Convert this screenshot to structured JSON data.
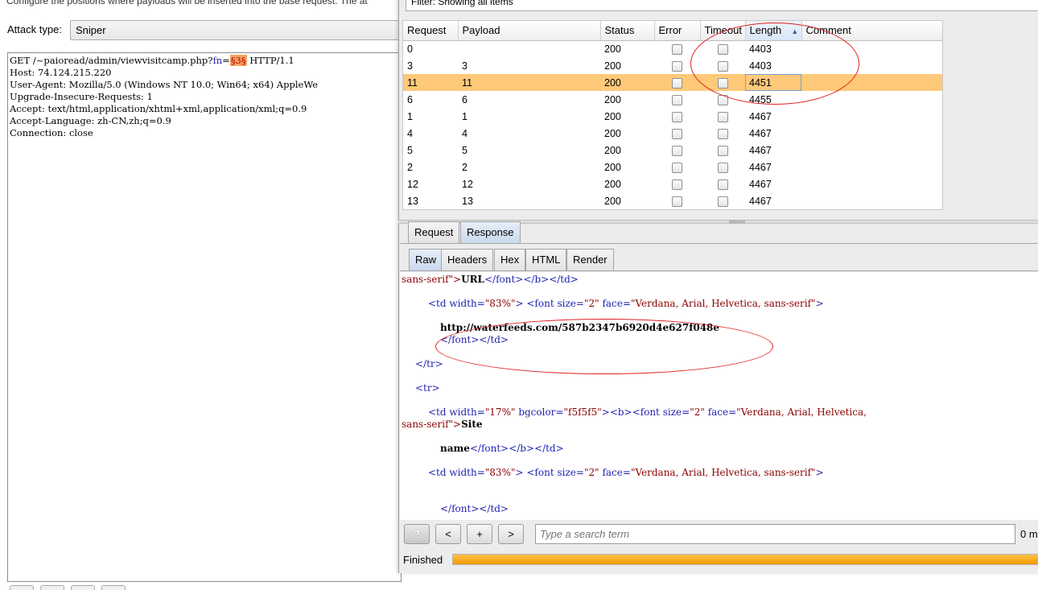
{
  "background_window": {
    "hint": "Configure the positions where payloads will be inserted into the base request. The at",
    "attack_type_label": "Attack type:",
    "attack_type_value": "Sniper",
    "request_lines": [
      {
        "before": "GET /~paioread/admin/viewvisitcamp.php?",
        "param": "fn",
        "eq": "=",
        "marker": "§3§",
        "after": " HTTP/1.1"
      },
      {
        "text": "Host: 74.124.215.220"
      },
      {
        "text": "User-Agent: Mozilla/5.0 (Windows NT 10.0; Win64; x64) AppleWe"
      },
      {
        "text": "Upgrade-Insecure-Requests: 1"
      },
      {
        "text": "Accept: text/html,application/xhtml+xml,application/xml;q=0.9"
      },
      {
        "text": "Accept-Language: zh-CN,zh;q=0.9"
      },
      {
        "text": "Connection: close"
      }
    ]
  },
  "results_window": {
    "filter_text": "Filter: Showing all items",
    "columns": [
      "Request",
      "Payload",
      "Status",
      "Error",
      "Timeout",
      "Length",
      "Comment"
    ],
    "sort_column": "Length",
    "sort_arrow": "▲",
    "rows": [
      {
        "request": "0",
        "payload": "",
        "status": "200",
        "length": "4403"
      },
      {
        "request": "3",
        "payload": "3",
        "status": "200",
        "length": "4403"
      },
      {
        "request": "11",
        "payload": "11",
        "status": "200",
        "length": "4451"
      },
      {
        "request": "6",
        "payload": "6",
        "status": "200",
        "length": "4455"
      },
      {
        "request": "1",
        "payload": "1",
        "status": "200",
        "length": "4467"
      },
      {
        "request": "4",
        "payload": "4",
        "status": "200",
        "length": "4467"
      },
      {
        "request": "5",
        "payload": "5",
        "status": "200",
        "length": "4467"
      },
      {
        "request": "2",
        "payload": "2",
        "status": "200",
        "length": "4467"
      },
      {
        "request": "12",
        "payload": "12",
        "status": "200",
        "length": "4467"
      },
      {
        "request": "13",
        "payload": "13",
        "status": "200",
        "length": "4467"
      }
    ],
    "selected_row": 2,
    "top_tabs": [
      "Request",
      "Response"
    ],
    "active_top_tab": "Response",
    "sub_tabs": [
      "Raw",
      "Headers",
      "Hex",
      "HTML",
      "Render"
    ],
    "active_sub_tab": "Raw",
    "response_text": {
      "l1_tail": "sans-serif\">",
      "l1_text": "URL",
      "l1_close": "</font></b></td>",
      "td83_open": "<td ",
      "td83_attr": "width=",
      "td83_val": "\"83%\"",
      "td83_mid": "> <font ",
      "size_attr": "size=",
      "size_val": "\"2\"",
      "face_attr": " face=",
      "face_val": "\"Verdana, Arial, Helvetica, sans-serif\"",
      "gt": ">",
      "url_text": "http://waterfeeds.com/587b2347b6920d4e627f048e",
      "font_td_close": "</font></td>",
      "tr_close": "</tr>",
      "tr_open": "<tr>",
      "td17_val": "\"17%\"",
      "bgcolor_attr": " bgcolor=",
      "bgcolor_val": "\"f5f5f5\"",
      "b_font": "><b><font ",
      "face_val_comma": "\"Verdana, Arial, Helvetica,",
      "sans_serif_tail": "sans-serif\">",
      "site_text": "Site",
      "name_text": "name",
      "name_close": "</font></b></td>"
    },
    "search": {
      "help_label": "?",
      "prev_label": "<",
      "add_label": "+",
      "next_label": ">",
      "placeholder": "Type a search term",
      "matches": "0 m"
    },
    "status": "Finished",
    "progress_fraction": 1.0
  },
  "colors": {
    "selected_row": "#ffc97a",
    "progress": "#f29a00",
    "annotation": "#e02020",
    "tag": "#1e1eb0",
    "value": "#8b0000"
  }
}
